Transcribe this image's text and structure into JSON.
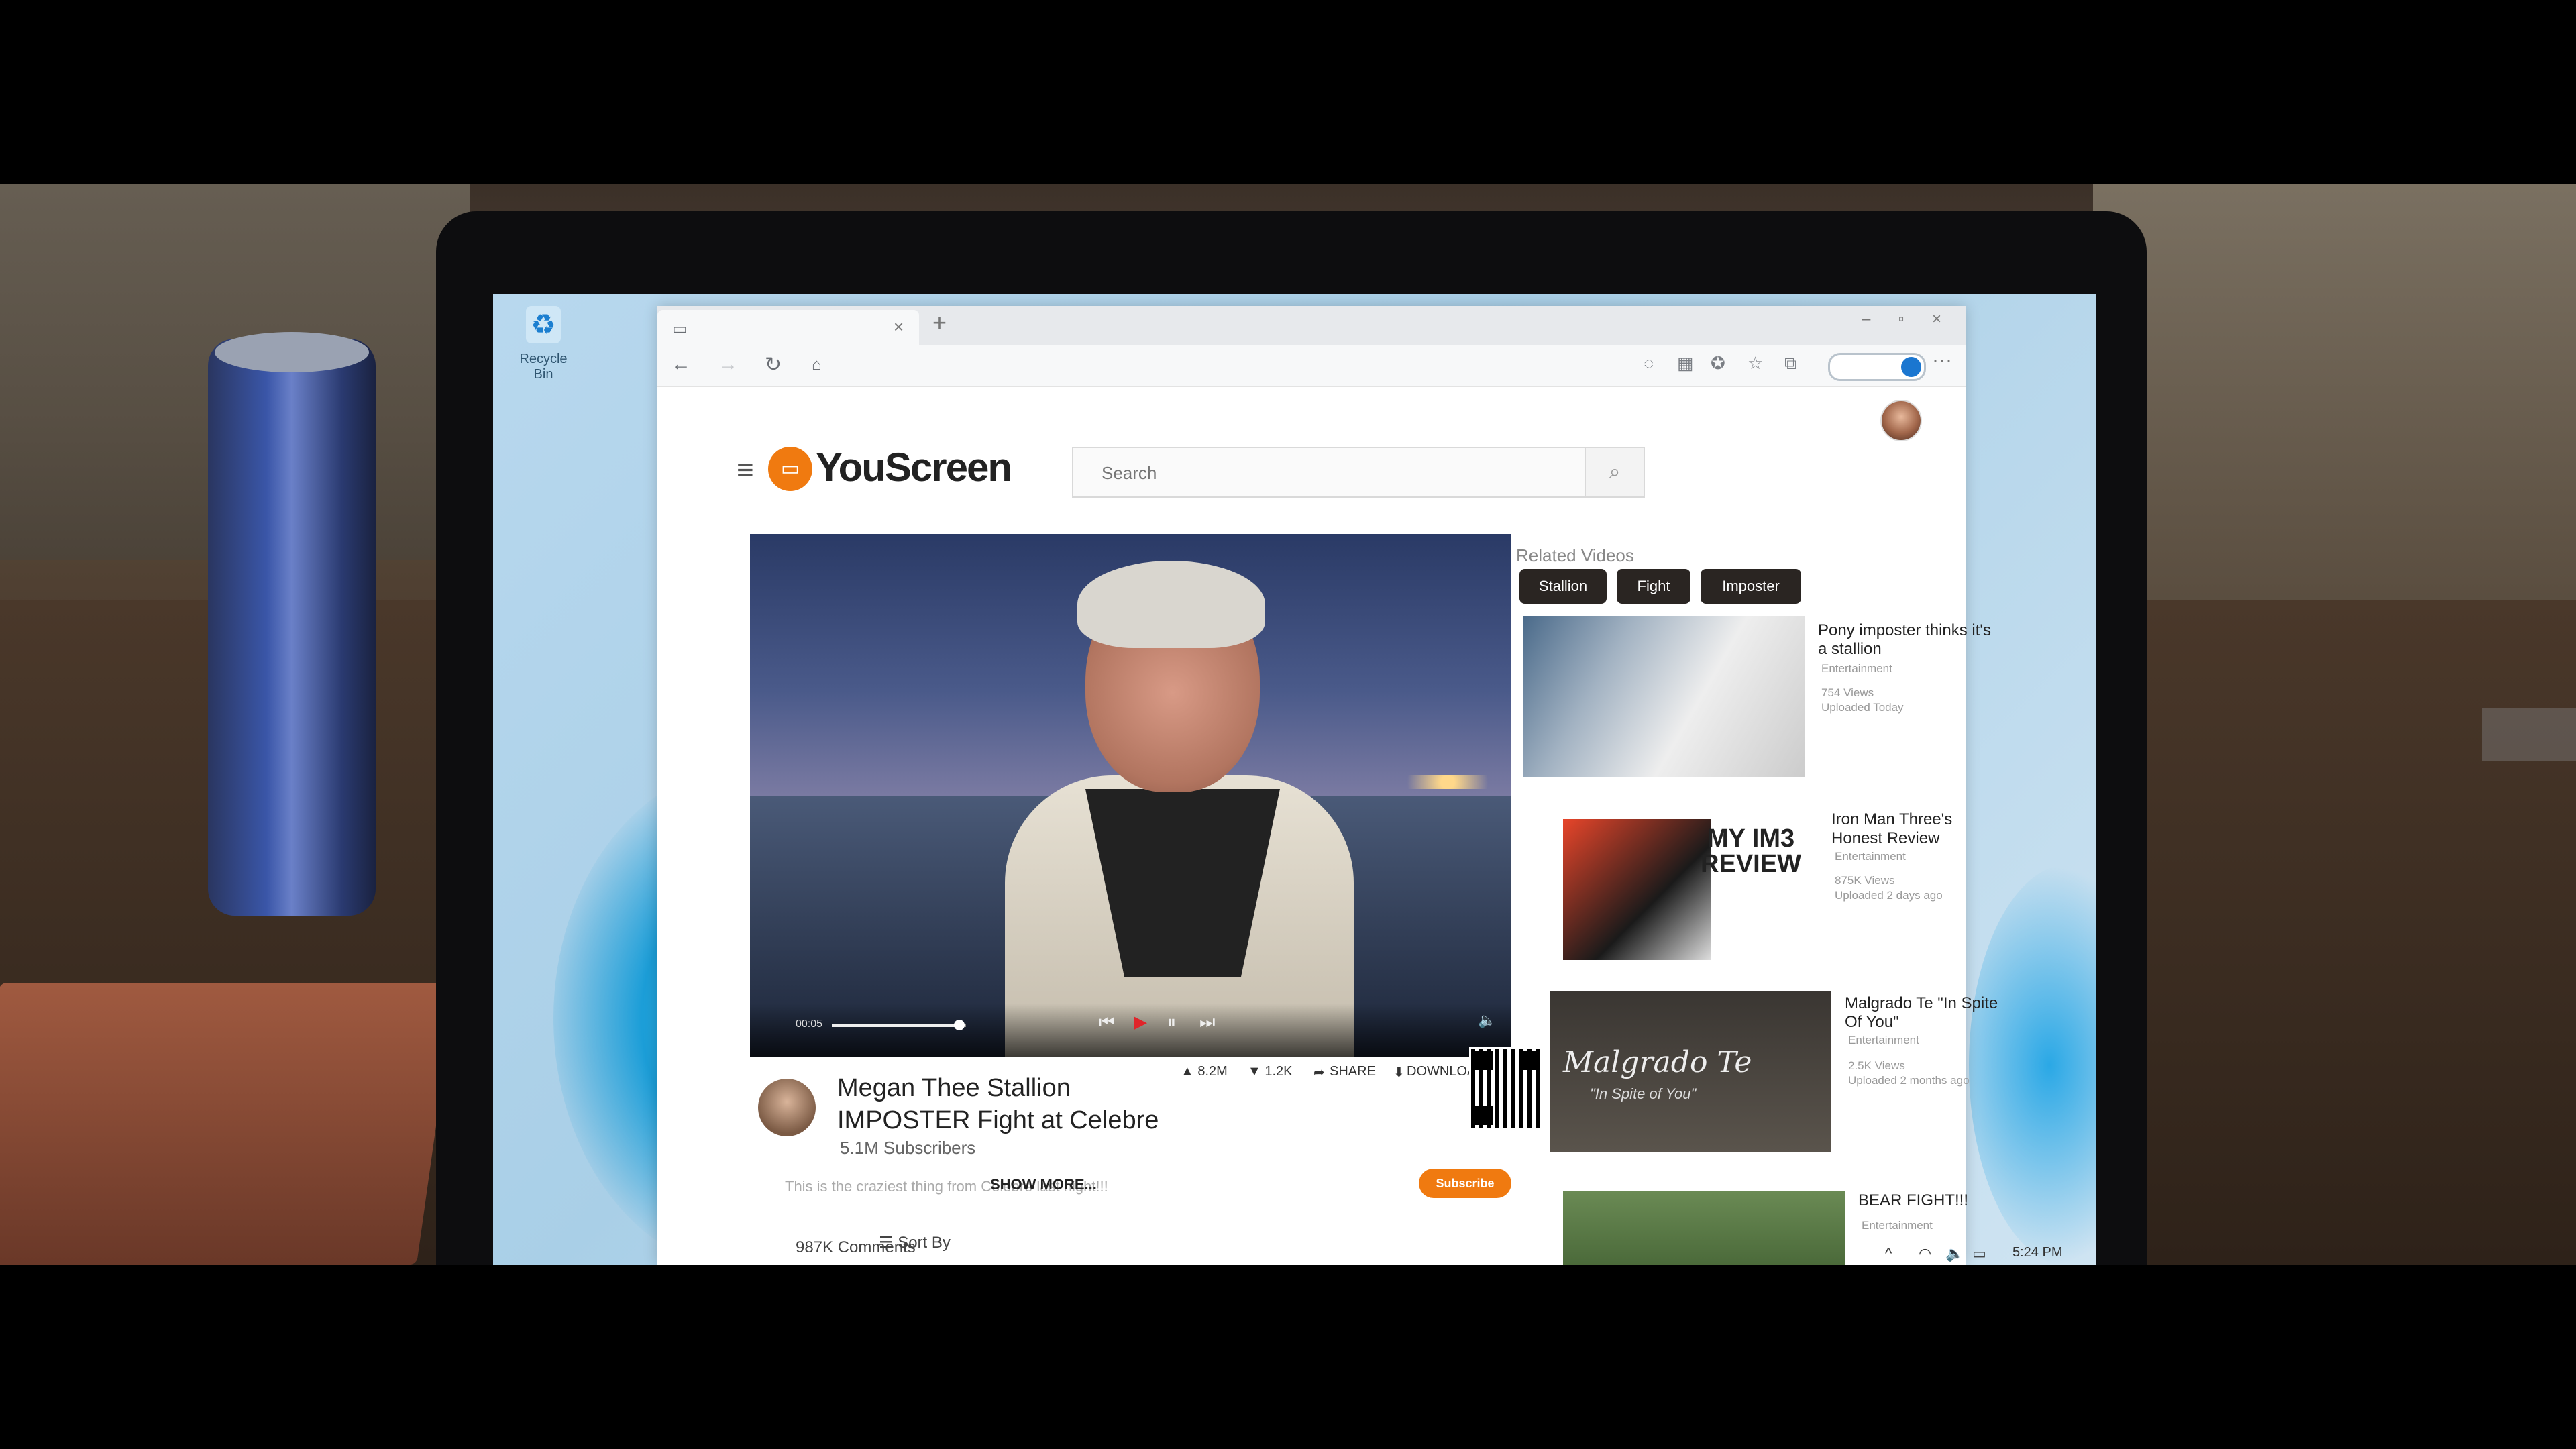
{
  "desktop": {
    "recycle_bin_label": "Recycle Bin"
  },
  "browser": {
    "tab_close": "×",
    "new_tab": "+",
    "window_controls": [
      "–",
      "▫",
      "×"
    ],
    "nav_icons": [
      "back-icon",
      "forward-icon",
      "refresh-icon",
      "home-icon"
    ],
    "toolbar_icons": [
      "read-aloud-icon",
      "apps-icon",
      "extensions-icon",
      "favorites-icon",
      "collections-icon"
    ],
    "more": "···"
  },
  "site": {
    "logo_text": "YouScreen",
    "search_placeholder": "Search"
  },
  "video": {
    "time": "00:05",
    "progress_fraction": 0.95,
    "title": "Megan Thee Stallion IMPOSTER Fight at Celebre",
    "subscribers": "5.1M  Subscribers",
    "likes": "▲ 8.2M",
    "dislikes": "▼ 1.2K",
    "share": "SHARE",
    "download": "DOWNLOAD",
    "description": "This is the craziest thing from Celebre last night!!!",
    "show_more": "SHOW MORE...",
    "subscribe": "Subscribe",
    "comments_count": "987K Comments",
    "sort_by": "Sort By"
  },
  "related": {
    "heading": "Related Videos",
    "chips": [
      "Stallion",
      "Fight",
      "Imposter"
    ],
    "items": [
      {
        "title": "Pony imposter thinks it's a stallion",
        "category": "Entertainment",
        "views": "754 Views",
        "uploaded": "Uploaded Today"
      },
      {
        "title": "Iron Man Three's Honest Review",
        "category": "Entertainment",
        "views": "875K Views",
        "uploaded": "Uploaded 2 days ago",
        "thumb_text": "MY IM3 REVIEW"
      },
      {
        "title": "Malgrado Te \"In Spite Of You\"",
        "category": "Entertainment",
        "views": "2.5K Views",
        "uploaded": "Uploaded 2 months ago",
        "thumb_text": "Malgrado Te",
        "thumb_sub": "\"In Spite of You\""
      },
      {
        "title": "BEAR FIGHT!!!",
        "category": "Entertainment"
      }
    ]
  },
  "taskbar": {
    "time": "5:24 PM"
  },
  "colors": {
    "brand": "#f07a10",
    "play": "#e0242a",
    "chip": "#2a2522"
  }
}
